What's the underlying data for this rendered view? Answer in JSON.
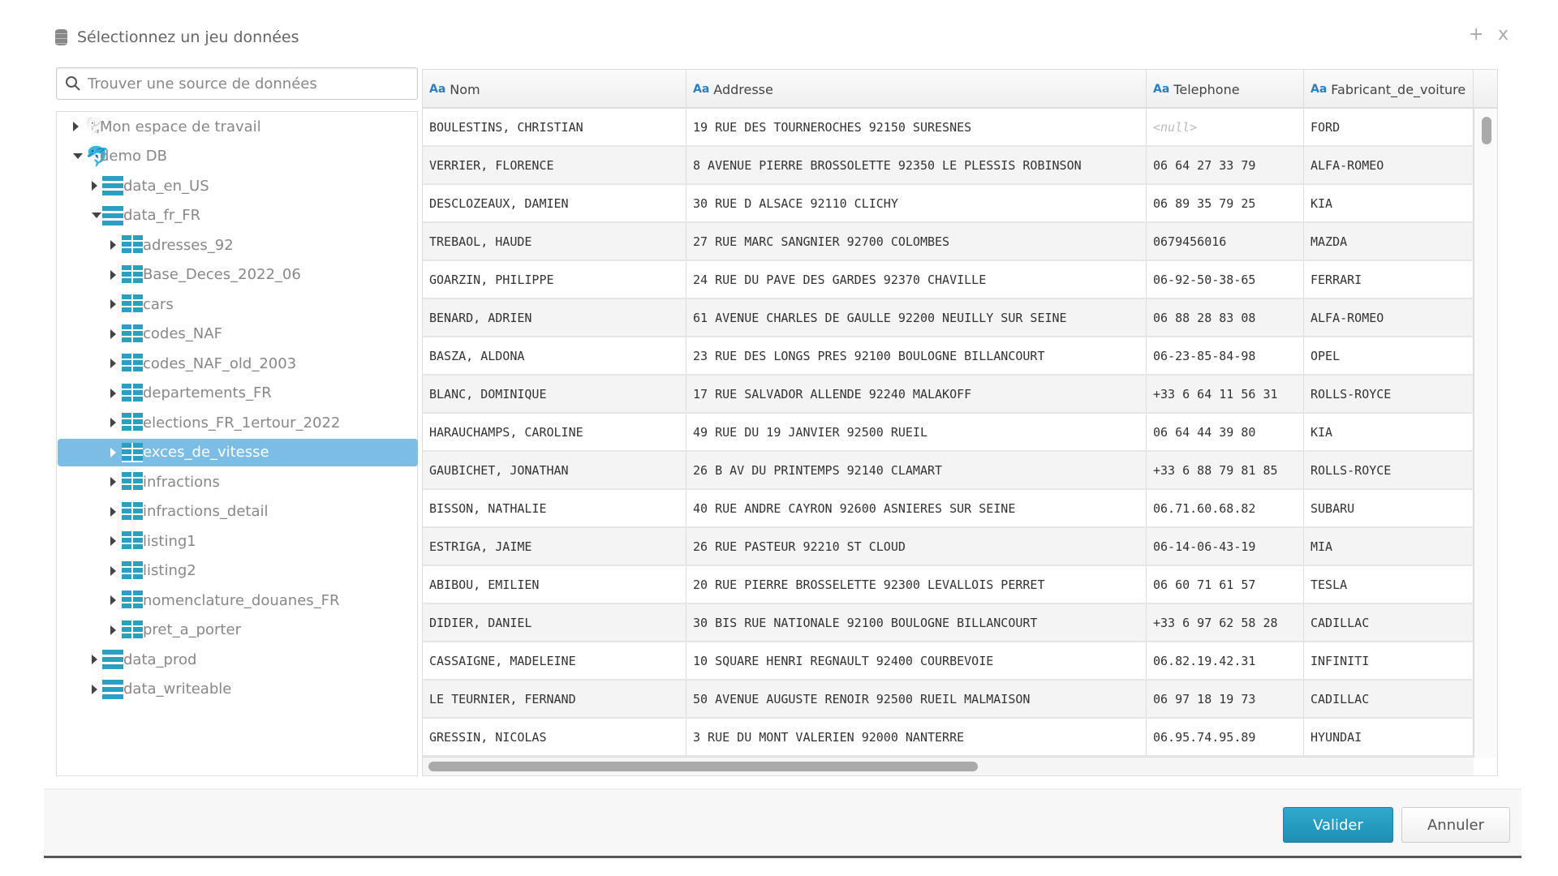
{
  "dialog": {
    "title": "Sélectionnez un jeu données",
    "icon": "database-icon",
    "maximize_label": "+",
    "close_label": "x"
  },
  "search": {
    "placeholder": "Trouver une source de données",
    "value": ""
  },
  "tree": [
    {
      "label": "Mon espace de travail",
      "level": 0,
      "type": "workspace",
      "expanded": false
    },
    {
      "label": "demo DB",
      "level": 0,
      "type": "db",
      "expanded": true
    },
    {
      "label": "data_en_US",
      "level": 1,
      "type": "schema",
      "expanded": false
    },
    {
      "label": "data_fr_FR",
      "level": 1,
      "type": "schema",
      "expanded": true
    },
    {
      "label": "adresses_92",
      "level": 2,
      "type": "table"
    },
    {
      "label": "Base_Deces_2022_06",
      "level": 2,
      "type": "table"
    },
    {
      "label": "cars",
      "level": 2,
      "type": "table"
    },
    {
      "label": "codes_NAF",
      "level": 2,
      "type": "table"
    },
    {
      "label": "codes_NAF_old_2003",
      "level": 2,
      "type": "table"
    },
    {
      "label": "departements_FR",
      "level": 2,
      "type": "table"
    },
    {
      "label": "elections_FR_1ertour_2022",
      "level": 2,
      "type": "table"
    },
    {
      "label": "exces_de_vitesse",
      "level": 2,
      "type": "table",
      "selected": true
    },
    {
      "label": "infractions",
      "level": 2,
      "type": "table"
    },
    {
      "label": "infractions_detail",
      "level": 2,
      "type": "table"
    },
    {
      "label": "listing1",
      "level": 2,
      "type": "table"
    },
    {
      "label": "listing2",
      "level": 2,
      "type": "table"
    },
    {
      "label": "nomenclature_douanes_FR",
      "level": 2,
      "type": "table"
    },
    {
      "label": "pret_a_porter",
      "level": 2,
      "type": "table"
    },
    {
      "label": "data_prod",
      "level": 1,
      "type": "schema",
      "expanded": false
    },
    {
      "label": "data_writeable",
      "level": 1,
      "type": "schema",
      "expanded": false
    }
  ],
  "table": {
    "type_badge": "Aa",
    "columns": [
      "Nom",
      "Addresse",
      "Telephone",
      "Fabricant_de_voiture"
    ],
    "rows": [
      [
        "BOULESTINS, CHRISTIAN",
        "19 RUE DES TOURNEROCHES 92150 SURESNES",
        "<null>",
        "FORD"
      ],
      [
        "VERRIER, FLORENCE",
        "8 AVENUE PIERRE BROSSOLETTE 92350 LE PLESSIS ROBINSON",
        "06 64 27 33 79",
        "ALFA-ROMEO"
      ],
      [
        "DESCLOZEAUX, DAMIEN",
        "30 RUE D ALSACE 92110 CLICHY",
        "06 89 35 79 25",
        "KIA"
      ],
      [
        "TREBAOL, HAUDE",
        "27 RUE MARC SANGNIER 92700 COLOMBES",
        "0679456016",
        "MAZDA"
      ],
      [
        "GOARZIN, PHILIPPE",
        "24 RUE DU PAVE DES GARDES 92370 CHAVILLE",
        "06-92-50-38-65",
        "FERRARI"
      ],
      [
        "BENARD, ADRIEN",
        "61 AVENUE CHARLES DE GAULLE 92200 NEUILLY SUR SEINE",
        "06 88 28 83 08",
        "ALFA-ROMEO"
      ],
      [
        "BASZA, ALDONA",
        "23 RUE DES LONGS PRES 92100 BOULOGNE BILLANCOURT",
        "06-23-85-84-98",
        "OPEL"
      ],
      [
        "BLANC, DOMINIQUE",
        "17 RUE SALVADOR ALLENDE 92240 MALAKOFF",
        "+33 6 64 11 56 31",
        "ROLLS-ROYCE"
      ],
      [
        "HARAUCHAMPS, CAROLINE",
        "49 RUE DU 19 JANVIER 92500 RUEIL",
        "06 64 44 39 80",
        "KIA"
      ],
      [
        "GAUBICHET, JONATHAN",
        "26 B AV DU PRINTEMPS 92140 CLAMART",
        "+33 6 88 79 81 85",
        "ROLLS-ROYCE"
      ],
      [
        "BISSON, NATHALIE",
        "40 RUE ANDRE CAYRON 92600 ASNIERES SUR SEINE",
        "06.71.60.68.82",
        "SUBARU"
      ],
      [
        "ESTRIGA, JAIME",
        "26 RUE PASTEUR 92210 ST CLOUD",
        "06-14-06-43-19",
        "MIA"
      ],
      [
        "ABIBOU, EMILIEN",
        "20 RUE PIERRE BROSSELETTE 92300 LEVALLOIS PERRET",
        "06 60 71 61 57",
        "TESLA"
      ],
      [
        "DIDIER, DANIEL",
        "30 BIS RUE NATIONALE 92100 BOULOGNE BILLANCOURT",
        "+33 6 97 62 58 28",
        "CADILLAC"
      ],
      [
        "CASSAIGNE, MADELEINE",
        "10 SQUARE HENRI REGNAULT 92400 COURBEVOIE",
        "06.82.19.42.31",
        "INFINITI"
      ],
      [
        "LE TEURNIER, FERNAND",
        "50 AVENUE AUGUSTE RENOIR 92500 RUEIL MALMAISON",
        "06 97 18 19 73",
        "CADILLAC"
      ],
      [
        "GRESSIN, NICOLAS",
        "3 RUE DU MONT VALERIEN 92000 NANTERRE",
        "06.95.74.95.89",
        "HYUNDAI"
      ]
    ]
  },
  "footer": {
    "ok_label": "Valider",
    "cancel_label": "Annuler"
  },
  "colors": {
    "accent": "#2a9fc0",
    "selection": "#7cbde6",
    "primary_button": "#1e90b5"
  }
}
